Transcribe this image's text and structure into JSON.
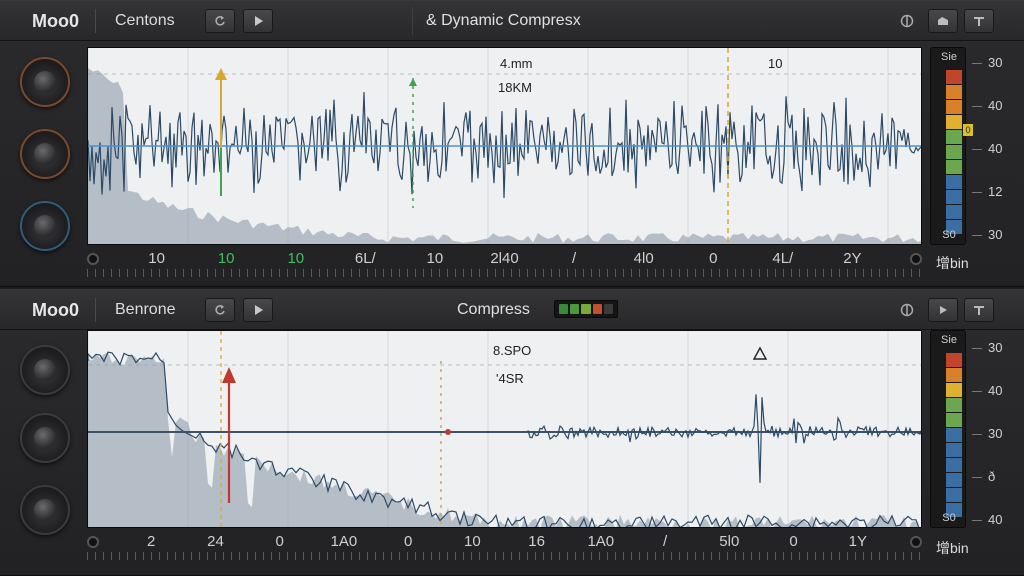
{
  "top": {
    "brand": "Moo0",
    "preset": "Centons",
    "title": "&  Dynamic Compresx",
    "labels": {
      "a": "4.mm",
      "b": "18KM",
      "c": "10"
    },
    "timeline": [
      {
        "text": "10",
        "color": "normal"
      },
      {
        "text": "10",
        "color": "green"
      },
      {
        "text": "10",
        "color": "green"
      },
      {
        "text": "6L/",
        "color": "normal"
      },
      {
        "text": "10",
        "color": "normal"
      },
      {
        "text": "2l40",
        "color": "normal"
      },
      {
        "text": "/",
        "color": "normal"
      },
      {
        "text": "4l0",
        "color": "normal"
      },
      {
        "text": "0",
        "color": "normal"
      },
      {
        "text": "4L/",
        "color": "normal"
      },
      {
        "text": "2Y",
        "color": "normal"
      }
    ],
    "meter": {
      "title": "Sie",
      "footer": "S0",
      "level_label": "0"
    },
    "scale": [
      "30",
      "40",
      "40",
      "12",
      "30"
    ],
    "gain_label": "增bin"
  },
  "bottom": {
    "brand": "Moo0",
    "preset": "Benrone",
    "title": "Compress",
    "labels": {
      "a": "8.SPO",
      "b": "'4SR"
    },
    "timeline": [
      {
        "text": "2",
        "color": "normal"
      },
      {
        "text": "24",
        "color": "normal"
      },
      {
        "text": "0",
        "color": "normal"
      },
      {
        "text": "1A0",
        "color": "normal"
      },
      {
        "text": "0",
        "color": "normal"
      },
      {
        "text": "10",
        "color": "normal"
      },
      {
        "text": "16",
        "color": "normal"
      },
      {
        "text": "1A0",
        "color": "normal"
      },
      {
        "text": "/",
        "color": "normal"
      },
      {
        "text": "5l0",
        "color": "normal"
      },
      {
        "text": "0",
        "color": "normal"
      },
      {
        "text": "1Y",
        "color": "normal"
      }
    ],
    "meter": {
      "title": "Sie",
      "footer": "S0"
    },
    "scale": [
      "30",
      "40",
      "30",
      "ð",
      "40"
    ],
    "gain_label": "增bin"
  },
  "colors": {
    "waveform": "#2c4a66",
    "fill": "#8795a3",
    "marker_yellow": "#d9a72b",
    "marker_red": "#c0392b",
    "marker_green": "#3fa34d",
    "meter_blue": "#3b6fa3",
    "meter_green": "#6aa84f",
    "meter_yellow": "#e0b030",
    "meter_orange": "#d9802a",
    "meter_red": "#c0452b"
  },
  "icons": {
    "header_buttons": [
      "loop-icon",
      "play-icon"
    ],
    "right_buttons": [
      "bypass-icon",
      "snapshot-icon",
      "menu-icon"
    ]
  }
}
